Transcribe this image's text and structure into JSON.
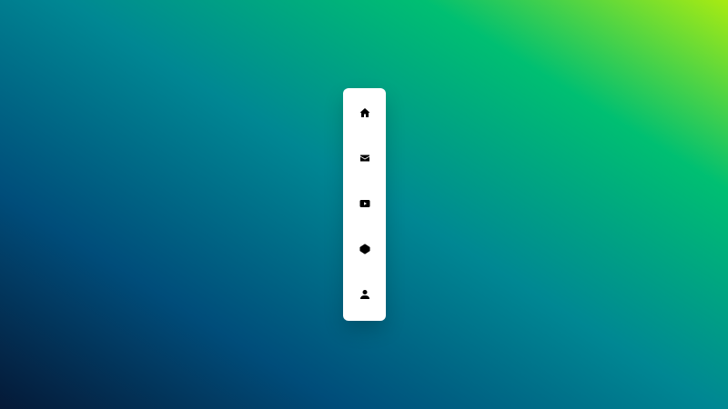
{
  "background": {
    "gradient_colors": [
      "#051937",
      "#004d7a",
      "#008793",
      "#00bf72",
      "#a8eb12"
    ]
  },
  "dock": {
    "background_color": "#ffffff",
    "items": [
      {
        "icon": "home-icon"
      },
      {
        "icon": "mail-icon"
      },
      {
        "icon": "youtube-icon"
      },
      {
        "icon": "codepen-icon"
      },
      {
        "icon": "user-icon"
      }
    ]
  }
}
